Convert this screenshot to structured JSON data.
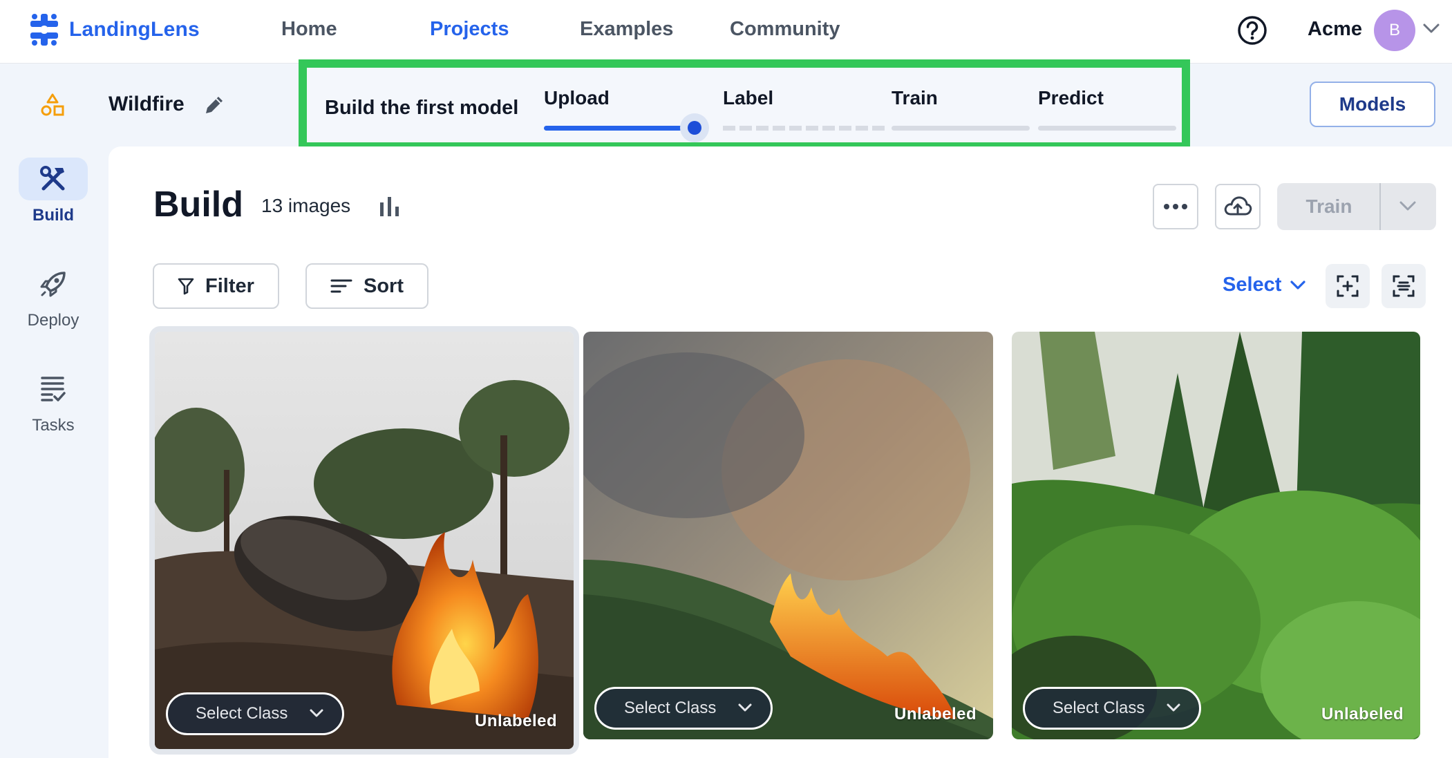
{
  "nav": {
    "brand": "LandingLens",
    "links": [
      "Home",
      "Projects",
      "Examples",
      "Community"
    ],
    "active_link": "Projects",
    "account_name": "Acme",
    "avatar_initial": "B"
  },
  "project": {
    "name": "Wildfire"
  },
  "stepper": {
    "title": "Build the first model",
    "steps": [
      "Upload",
      "Label",
      "Train",
      "Predict"
    ],
    "current_step": "Label"
  },
  "models_button": "Models",
  "sidebar": {
    "items": [
      {
        "label": "Build",
        "icon": "hammer-wrench-icon",
        "active": true
      },
      {
        "label": "Deploy",
        "icon": "rocket-icon",
        "active": false
      },
      {
        "label": "Tasks",
        "icon": "task-list-icon",
        "active": false
      }
    ]
  },
  "build": {
    "title": "Build",
    "image_count": "13 images",
    "train_label": "Train",
    "filter_label": "Filter",
    "sort_label": "Sort",
    "select_label": "Select"
  },
  "images": [
    {
      "class_placeholder": "Select Class",
      "status": "Unlabeled",
      "scene": "burning-log"
    },
    {
      "class_placeholder": "Select Class",
      "status": "Unlabeled",
      "scene": "forest-fire-smoke"
    },
    {
      "class_placeholder": "Select Class",
      "status": "Unlabeled",
      "scene": "green-forest"
    }
  ],
  "colors": {
    "accent": "#2563eb",
    "highlight_border": "#34c759",
    "avatar": "#b794e8"
  }
}
